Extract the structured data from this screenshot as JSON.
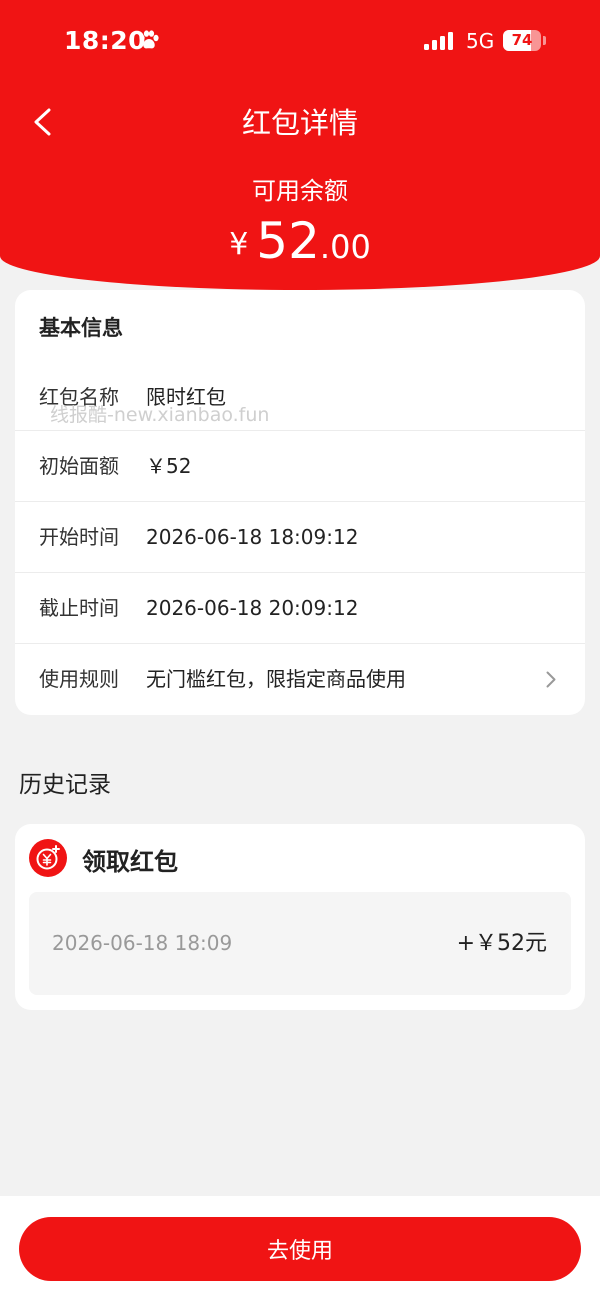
{
  "status_bar": {
    "time": "18:20",
    "network": "5G",
    "battery_level": 74,
    "battery_text": "74"
  },
  "header": {
    "title": "红包详情",
    "balance_label": "可用余额",
    "balance_currency": "¥",
    "balance_integer": "52",
    "balance_decimal": ".00"
  },
  "watermark": "线报酷-new.xianbao.fun",
  "basic_info": {
    "title": "基本信息",
    "rows": [
      {
        "label": "红包名称",
        "value": "限时红包"
      },
      {
        "label": "初始面额",
        "value": "￥52"
      },
      {
        "label": "开始时间",
        "value": "2026-06-18 18:09:12"
      },
      {
        "label": "截止时间",
        "value": "2026-06-18 20:09:12"
      },
      {
        "label": "使用规则",
        "value": "无门槛红包，限指定商品使用"
      }
    ]
  },
  "history": {
    "title": "历史记录",
    "item_title": "领取红包",
    "entry_time": "2026-06-18 18:09",
    "entry_amount": "+￥52元"
  },
  "bottom": {
    "use_label": "去使用"
  },
  "colors": {
    "accent": "#f01414",
    "background": "#f2f2f2",
    "card": "#ffffff",
    "muted_text": "#999999"
  },
  "icons": {
    "back": "chevron-left-icon",
    "rule_more": "chevron-right-icon",
    "history_item": "coin-icon",
    "status_paw": "paw-icon",
    "status_signal": "signal-icon",
    "status_battery": "battery-icon"
  }
}
